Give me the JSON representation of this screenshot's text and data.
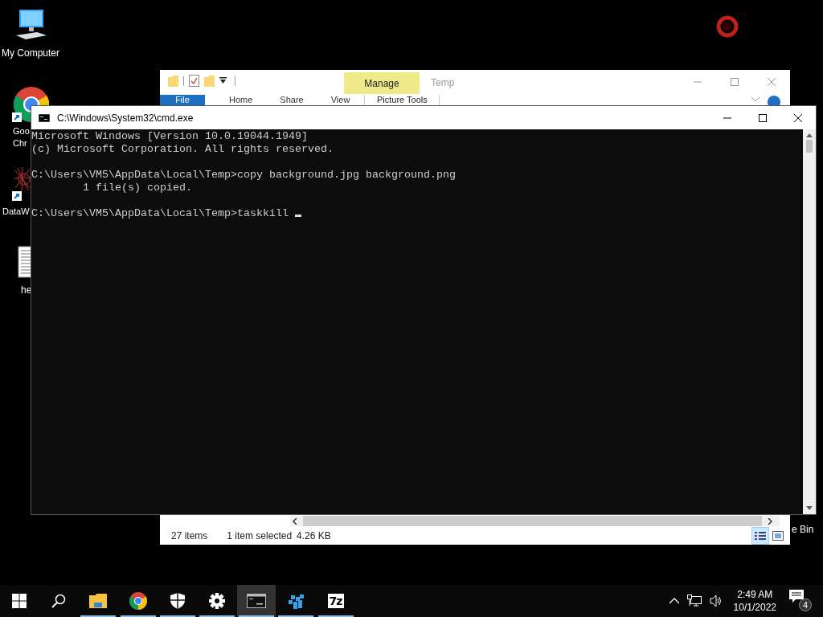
{
  "desktop_icons": [
    {
      "kind": "computer",
      "label_lines": [
        "My Computer"
      ],
      "shortcut": false
    },
    {
      "kind": "chrome",
      "label_lines": [
        "Goo",
        "Chr"
      ],
      "shortcut": true
    },
    {
      "kind": "network",
      "label_lines": [
        "DataW"
      ],
      "shortcut": true
    },
    {
      "kind": "document",
      "label_lines": [
        "he"
      ],
      "shortcut": false
    },
    {
      "kind": "recycle",
      "label_lines": [
        "e Bin"
      ],
      "shortcut": false
    },
    {
      "kind": "ring",
      "shortcut": false
    }
  ],
  "explorer": {
    "title": "Temp",
    "context_tab": "Manage",
    "context_group": "Picture Tools",
    "ribbon_tabs": [
      {
        "label": "File",
        "kind": "file"
      },
      {
        "label": "Home",
        "kind": "tab"
      },
      {
        "label": "Share",
        "kind": "tab"
      },
      {
        "label": "View",
        "kind": "tab"
      }
    ],
    "status_bar": {
      "item_count": "27 items",
      "selection": "1 item selected",
      "size": "4.26 KB"
    },
    "view_buttons": [
      {
        "kind": "details",
        "selected": true
      },
      {
        "kind": "large-icons",
        "selected": false
      }
    ]
  },
  "cmd": {
    "title": "C:\\Windows\\System32\\cmd.exe",
    "paragraphs": [
      [
        "Microsoft Windows [Version 10.0.19044.1949]",
        "(c) Microsoft Corporation. All rights reserved."
      ],
      [
        "C:\\Users\\VM5\\AppData\\Local\\Temp>copy background.jpg background.png",
        "        1 file(s) copied."
      ],
      [
        "C:\\Users\\VM5\\AppData\\Local\\Temp>taskkill "
      ]
    ],
    "cursor": true
  },
  "taskbar": {
    "items": [
      {
        "kind": "start",
        "running": false,
        "selected": false
      },
      {
        "kind": "search",
        "running": false,
        "selected": false
      },
      {
        "kind": "explorer",
        "running": true,
        "selected": false
      },
      {
        "kind": "chrome",
        "running": true,
        "selected": false
      },
      {
        "kind": "security",
        "running": true,
        "selected": false
      },
      {
        "kind": "settings",
        "running": true,
        "selected": false
      },
      {
        "kind": "cmd",
        "running": true,
        "selected": true
      },
      {
        "kind": "cubes",
        "running": true,
        "selected": false
      },
      {
        "kind": "sevenzip",
        "running": true,
        "selected": false,
        "icon_text": "7z"
      }
    ],
    "time": "2:49 AM",
    "date": "10/1/2022",
    "notification_count": "4"
  }
}
